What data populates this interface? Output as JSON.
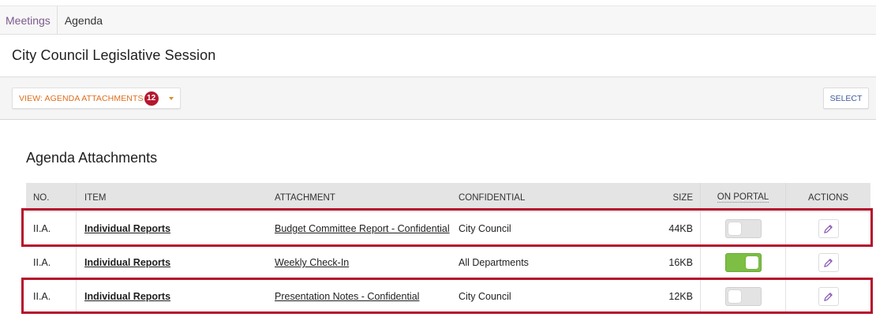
{
  "breadcrumb": {
    "meetings": "Meetings",
    "agenda": "Agenda"
  },
  "page": {
    "title": "City Council Legislative Session"
  },
  "toolbar": {
    "view_label": "VIEW: AGENDA ATTACHMENTS",
    "view_count": "12",
    "select_label": "SELECT"
  },
  "section": {
    "title": "Agenda Attachments"
  },
  "table": {
    "headers": {
      "no": "NO.",
      "item": "ITEM",
      "attachment": "ATTACHMENT",
      "confidential": "CONFIDENTIAL",
      "size": "SIZE",
      "on_portal": "ON PORTAL",
      "actions": "ACTIONS"
    },
    "rows": [
      {
        "no": "II.A.",
        "item": "Individual Reports",
        "attachment": "Budget Committee Report - Confidential",
        "confidential": "City Council",
        "size": "44KB",
        "on_portal": false,
        "highlighted": true
      },
      {
        "no": "II.A.",
        "item": "Individual Reports",
        "attachment": "Weekly Check-In",
        "confidential": "All Departments",
        "size": "16KB",
        "on_portal": true,
        "highlighted": false
      },
      {
        "no": "II.A.",
        "item": "Individual Reports",
        "attachment": "Presentation Notes - Confidential",
        "confidential": "City Council",
        "size": "12KB",
        "on_portal": false,
        "highlighted": true
      }
    ]
  },
  "icons": {
    "caret": "caret-down-icon",
    "edit": "pencil-icon"
  },
  "colors": {
    "accent_orange": "#e06d1c",
    "badge_red": "#b5172e",
    "highlight_red": "#b5102c",
    "toggle_on": "#7cbf44",
    "link_blue": "#3d5a9e",
    "breadcrumb_purple": "#7a5a8c"
  }
}
